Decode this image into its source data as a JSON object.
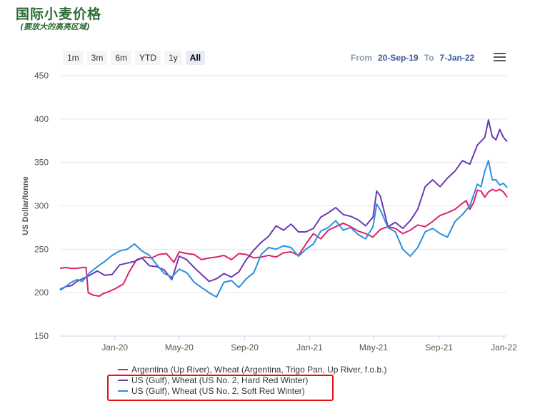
{
  "header": {
    "title": "国际小麦价格",
    "subtitle": "(要放大的高亮区域)"
  },
  "range_selector": {
    "buttons": [
      "1m",
      "3m",
      "6m",
      "YTD",
      "1y",
      "All"
    ],
    "active": "All",
    "from_label": "From",
    "from_value": "20-Sep-19",
    "to_label": "To",
    "to_value": "7-Jan-22"
  },
  "chart_data": {
    "type": "line",
    "title": "",
    "ylabel": "US Dollar/tonne",
    "ylim": [
      150,
      450
    ],
    "yticks": [
      150,
      200,
      250,
      300,
      350,
      400,
      450
    ],
    "xlim": [
      "2019-09-20",
      "2022-01-07"
    ],
    "xticks": [
      {
        "date": "2020-01-01",
        "label": "Jan-20"
      },
      {
        "date": "2020-05-01",
        "label": "May-20"
      },
      {
        "date": "2020-09-01",
        "label": "Sep-20"
      },
      {
        "date": "2021-01-01",
        "label": "Jan-21"
      },
      {
        "date": "2021-05-01",
        "label": "May-21"
      },
      {
        "date": "2021-09-01",
        "label": "Sep-21"
      },
      {
        "date": "2022-01-01",
        "label": "Jan-22"
      }
    ],
    "grid": true,
    "legend_position": "bottom",
    "series": [
      {
        "name": "Argentina (Up River), Wheat (Argentina, Trigo Pan, Up River, f.o.b.)",
        "color": "#e0206a",
        "points": [
          [
            "2019-09-20",
            228
          ],
          [
            "2019-10-01",
            229
          ],
          [
            "2019-10-11",
            228
          ],
          [
            "2019-10-22",
            228
          ],
          [
            "2019-11-01",
            229
          ],
          [
            "2019-11-08",
            229
          ],
          [
            "2019-11-12",
            200
          ],
          [
            "2019-11-22",
            197
          ],
          [
            "2019-12-03",
            196
          ],
          [
            "2019-12-10",
            199
          ],
          [
            "2019-12-20",
            201
          ],
          [
            "2020-01-03",
            205
          ],
          [
            "2020-01-17",
            210
          ],
          [
            "2020-01-28",
            224
          ],
          [
            "2020-02-11",
            238
          ],
          [
            "2020-02-25",
            241
          ],
          [
            "2020-03-10",
            240
          ],
          [
            "2020-03-24",
            244
          ],
          [
            "2020-04-07",
            245
          ],
          [
            "2020-04-21",
            235
          ],
          [
            "2020-05-01",
            247
          ],
          [
            "2020-05-15",
            245
          ],
          [
            "2020-05-29",
            244
          ],
          [
            "2020-06-12",
            238
          ],
          [
            "2020-06-26",
            240
          ],
          [
            "2020-07-10",
            241
          ],
          [
            "2020-07-24",
            243
          ],
          [
            "2020-08-07",
            238
          ],
          [
            "2020-08-21",
            245
          ],
          [
            "2020-09-04",
            244
          ],
          [
            "2020-09-18",
            240
          ],
          [
            "2020-10-02",
            241
          ],
          [
            "2020-10-16",
            243
          ],
          [
            "2020-10-30",
            241
          ],
          [
            "2020-11-13",
            246
          ],
          [
            "2020-11-27",
            247
          ],
          [
            "2020-12-11",
            243
          ],
          [
            "2020-12-25",
            256
          ],
          [
            "2021-01-08",
            268
          ],
          [
            "2021-01-22",
            262
          ],
          [
            "2021-02-05",
            272
          ],
          [
            "2021-02-19",
            276
          ],
          [
            "2021-03-05",
            280
          ],
          [
            "2021-03-19",
            276
          ],
          [
            "2021-04-02",
            271
          ],
          [
            "2021-04-16",
            268
          ],
          [
            "2021-04-30",
            264
          ],
          [
            "2021-05-14",
            273
          ],
          [
            "2021-05-28",
            276
          ],
          [
            "2021-06-11",
            274
          ],
          [
            "2021-06-25",
            268
          ],
          [
            "2021-07-09",
            272
          ],
          [
            "2021-07-23",
            278
          ],
          [
            "2021-08-06",
            276
          ],
          [
            "2021-08-20",
            282
          ],
          [
            "2021-09-03",
            289
          ],
          [
            "2021-09-17",
            292
          ],
          [
            "2021-10-01",
            296
          ],
          [
            "2021-10-15",
            303
          ],
          [
            "2021-10-22",
            306
          ],
          [
            "2021-10-29",
            296
          ],
          [
            "2021-11-05",
            304
          ],
          [
            "2021-11-12",
            318
          ],
          [
            "2021-11-19",
            317
          ],
          [
            "2021-11-26",
            310
          ],
          [
            "2021-12-03",
            316
          ],
          [
            "2021-12-10",
            319
          ],
          [
            "2021-12-17",
            317
          ],
          [
            "2021-12-24",
            319
          ],
          [
            "2021-12-31",
            316
          ],
          [
            "2022-01-07",
            310
          ]
        ]
      },
      {
        "name": "US (Gulf), Wheat (US No. 2, Hard Red Winter)",
        "color": "#6a3ab4",
        "points": [
          [
            "2019-09-20",
            203
          ],
          [
            "2019-10-01",
            207
          ],
          [
            "2019-10-11",
            208
          ],
          [
            "2019-10-22",
            213
          ],
          [
            "2019-11-01",
            216
          ],
          [
            "2019-11-15",
            220
          ],
          [
            "2019-11-29",
            225
          ],
          [
            "2019-12-13",
            220
          ],
          [
            "2019-12-27",
            221
          ],
          [
            "2020-01-10",
            232
          ],
          [
            "2020-01-24",
            234
          ],
          [
            "2020-02-07",
            236
          ],
          [
            "2020-02-21",
            240
          ],
          [
            "2020-03-06",
            231
          ],
          [
            "2020-03-20",
            230
          ],
          [
            "2020-04-03",
            226
          ],
          [
            "2020-04-17",
            215
          ],
          [
            "2020-05-01",
            242
          ],
          [
            "2020-05-15",
            238
          ],
          [
            "2020-05-29",
            229
          ],
          [
            "2020-06-12",
            221
          ],
          [
            "2020-06-26",
            213
          ],
          [
            "2020-07-10",
            216
          ],
          [
            "2020-07-24",
            222
          ],
          [
            "2020-08-07",
            218
          ],
          [
            "2020-08-21",
            224
          ],
          [
            "2020-09-04",
            238
          ],
          [
            "2020-09-18",
            249
          ],
          [
            "2020-10-02",
            258
          ],
          [
            "2020-10-16",
            265
          ],
          [
            "2020-10-30",
            277
          ],
          [
            "2020-11-13",
            272
          ],
          [
            "2020-11-27",
            279
          ],
          [
            "2020-12-11",
            270
          ],
          [
            "2020-12-25",
            270
          ],
          [
            "2021-01-08",
            274
          ],
          [
            "2021-01-22",
            287
          ],
          [
            "2021-02-05",
            292
          ],
          [
            "2021-02-19",
            298
          ],
          [
            "2021-03-05",
            290
          ],
          [
            "2021-03-19",
            288
          ],
          [
            "2021-04-02",
            284
          ],
          [
            "2021-04-16",
            277
          ],
          [
            "2021-04-30",
            287
          ],
          [
            "2021-05-07",
            317
          ],
          [
            "2021-05-14",
            311
          ],
          [
            "2021-05-28",
            276
          ],
          [
            "2021-06-11",
            281
          ],
          [
            "2021-06-25",
            274
          ],
          [
            "2021-07-09",
            283
          ],
          [
            "2021-07-23",
            296
          ],
          [
            "2021-08-06",
            322
          ],
          [
            "2021-08-20",
            330
          ],
          [
            "2021-09-03",
            322
          ],
          [
            "2021-09-17",
            332
          ],
          [
            "2021-10-01",
            340
          ],
          [
            "2021-10-15",
            352
          ],
          [
            "2021-10-29",
            348
          ],
          [
            "2021-11-12",
            370
          ],
          [
            "2021-11-26",
            379
          ],
          [
            "2021-12-03",
            399
          ],
          [
            "2021-12-10",
            380
          ],
          [
            "2021-12-17",
            376
          ],
          [
            "2021-12-24",
            388
          ],
          [
            "2021-12-31",
            379
          ],
          [
            "2022-01-07",
            374
          ]
        ]
      },
      {
        "name": "US (Gulf), Wheat (US No. 2, Soft Red Winter)",
        "color": "#2b8fe0",
        "points": [
          [
            "2019-09-20",
            204
          ],
          [
            "2019-10-01",
            207
          ],
          [
            "2019-10-11",
            212
          ],
          [
            "2019-10-22",
            215
          ],
          [
            "2019-11-01",
            213
          ],
          [
            "2019-11-15",
            223
          ],
          [
            "2019-11-29",
            230
          ],
          [
            "2019-12-13",
            236
          ],
          [
            "2019-12-27",
            243
          ],
          [
            "2020-01-10",
            248
          ],
          [
            "2020-01-24",
            250
          ],
          [
            "2020-02-07",
            256
          ],
          [
            "2020-02-21",
            248
          ],
          [
            "2020-03-06",
            243
          ],
          [
            "2020-03-20",
            232
          ],
          [
            "2020-04-03",
            222
          ],
          [
            "2020-04-17",
            218
          ],
          [
            "2020-05-01",
            227
          ],
          [
            "2020-05-15",
            223
          ],
          [
            "2020-05-29",
            212
          ],
          [
            "2020-06-12",
            206
          ],
          [
            "2020-06-26",
            200
          ],
          [
            "2020-07-10",
            195
          ],
          [
            "2020-07-24",
            212
          ],
          [
            "2020-08-07",
            214
          ],
          [
            "2020-08-21",
            206
          ],
          [
            "2020-09-04",
            216
          ],
          [
            "2020-09-18",
            223
          ],
          [
            "2020-10-02",
            244
          ],
          [
            "2020-10-16",
            252
          ],
          [
            "2020-10-30",
            250
          ],
          [
            "2020-11-13",
            254
          ],
          [
            "2020-11-27",
            252
          ],
          [
            "2020-12-11",
            242
          ],
          [
            "2020-12-25",
            250
          ],
          [
            "2021-01-08",
            256
          ],
          [
            "2021-01-22",
            271
          ],
          [
            "2021-02-05",
            275
          ],
          [
            "2021-02-19",
            283
          ],
          [
            "2021-03-05",
            272
          ],
          [
            "2021-03-19",
            275
          ],
          [
            "2021-04-02",
            267
          ],
          [
            "2021-04-16",
            262
          ],
          [
            "2021-04-30",
            276
          ],
          [
            "2021-05-07",
            302
          ],
          [
            "2021-05-14",
            295
          ],
          [
            "2021-05-28",
            275
          ],
          [
            "2021-06-11",
            270
          ],
          [
            "2021-06-25",
            250
          ],
          [
            "2021-07-09",
            242
          ],
          [
            "2021-07-23",
            252
          ],
          [
            "2021-08-06",
            270
          ],
          [
            "2021-08-20",
            274
          ],
          [
            "2021-09-03",
            268
          ],
          [
            "2021-09-17",
            264
          ],
          [
            "2021-10-01",
            282
          ],
          [
            "2021-10-15",
            290
          ],
          [
            "2021-10-29",
            300
          ],
          [
            "2021-11-12",
            325
          ],
          [
            "2021-11-19",
            322
          ],
          [
            "2021-11-26",
            340
          ],
          [
            "2021-12-03",
            352
          ],
          [
            "2021-12-10",
            330
          ],
          [
            "2021-12-17",
            330
          ],
          [
            "2021-12-24",
            324
          ],
          [
            "2021-12-31",
            326
          ],
          [
            "2022-01-07",
            321
          ]
        ]
      }
    ]
  },
  "legend": {
    "items": [
      "Argentina (Up River), Wheat (Argentina, Trigo Pan, Up River, f.o.b.)",
      "US (Gulf), Wheat (US No. 2, Hard Red Winter)",
      "US (Gulf), Wheat (US No. 2, Soft Red Winter)"
    ]
  }
}
